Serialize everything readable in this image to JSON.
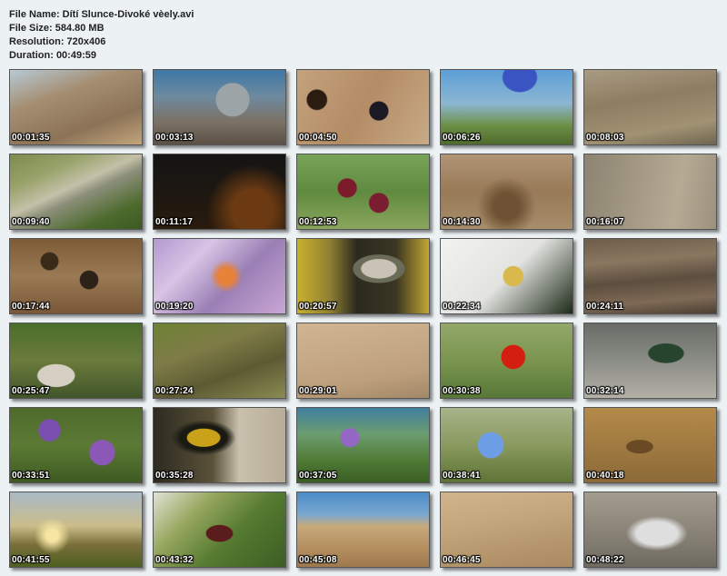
{
  "info": {
    "file_name": "File Name: Dítí Slunce-Divoké vèely.avi",
    "file_size": "File Size: 584.80 MB",
    "resolution": "Resolution: 720x406",
    "duration": "Duration: 00:49:59"
  },
  "thumbnails": [
    {
      "time": "00:01:35",
      "bg": "linear-gradient(160deg,#b7c9d6 0%,#a48d70 35%,#8c7357 70%,#c2a57c 100%)"
    },
    {
      "time": "00:03:13",
      "bg": "radial-gradient(circle at 60% 40%,#9da4a7 0 18%,transparent 19%),linear-gradient(180deg,#3e77a6 0%,#6d8aa0 35%,#7b7164 70%,#5a5046 100%)"
    },
    {
      "time": "00:04:50",
      "bg": "radial-gradient(circle at 15% 40%,#2a1c10 0 8%,transparent 9%),radial-gradient(circle at 62% 55%,#1b1a24 0 10%,transparent 11%),linear-gradient(120deg,#c3a27e 0%,#b48c66 50%,#c7aa86 100%)"
    },
    {
      "time": "00:06:26",
      "bg": "radial-gradient(ellipse at 60% 10%,#3a55c2 0 15%,transparent 16%),linear-gradient(180deg,#5c9fd7 0%,#8cb6d2 45%,#6c8f43 75%,#4e6a2e 100%)"
    },
    {
      "time": "00:08:03",
      "bg": "linear-gradient(170deg,#a99b83 0%,#8d7d62 40%,#a19273 75%,#6f6550 100%)"
    },
    {
      "time": "00:09:40",
      "bg": "linear-gradient(155deg,#7d8b4d 0%,#97a26a 25%,#c5c0a8 45%,#8b8f7a 55%,#4c6a2c 80%,#3d5a24 100%)"
    },
    {
      "time": "00:11:17",
      "bg": "radial-gradient(circle at 75% 75%,#6b3a12 0 18%,transparent 40%),linear-gradient(180deg,#141414 0%,#1f1810 60%,#2a1b0d 100%)"
    },
    {
      "time": "00:12:53",
      "bg": "radial-gradient(circle at 38% 45%,#7b1b2c 0 10%,transparent 11%),radial-gradient(circle at 62% 65%,#7a1d31 0 10%,transparent 11%),linear-gradient(180deg,#7aa35a 0%,#5f8a3f 50%,#8aa65c 100%)"
    },
    {
      "time": "00:14:30",
      "bg": "radial-gradient(circle at 50% 70%,#6d5233 0 15%,transparent 35%),linear-gradient(180deg,#b09474 0%,#987a58 50%,#a78d6b 100%)"
    },
    {
      "time": "00:16:07",
      "bg": "linear-gradient(100deg,#8c8371 0%,#a39984 40%,#b5ab95 70%,#9b917c 100%)"
    },
    {
      "time": "00:17:44",
      "bg": "radial-gradient(circle at 30% 30%,#3a2a18 0 8%,transparent 9%),radial-gradient(circle at 60% 55%,#2d2218 0 10%,transparent 11%),linear-gradient(180deg,#7d5b36 0%,#9a7a54 50%,#7a5838 100%)"
    },
    {
      "time": "00:19:20",
      "bg": "radial-gradient(circle at 55% 50%,#e6823a 0 10%,transparent 20%),linear-gradient(135deg,#b29ad0 0%,#d8c4e4 30%,#9a7fb5 60%,#c9a6d4 100%)"
    },
    {
      "time": "00:20:57",
      "bg": "radial-gradient(ellipse at 62% 40%,#c9c2b5 0 15%,#6b6b5a 16% 22%,transparent 23%),linear-gradient(90deg,#c9b12e 0%,#8f8032 25%,#2b2a20 45%,#3b3522 75%,#c2a634 100%)"
    },
    {
      "time": "00:22:34",
      "bg": "radial-gradient(circle at 55% 50%,#d9b84e 0 12%,transparent 13%),linear-gradient(135deg,#f2f2f0 0%,#e3e4e1 50%,#1d2a18 100%)"
    },
    {
      "time": "00:24:11",
      "bg": "linear-gradient(175deg,#6e5c4a 0%,#8a7760 30%,#5d4e3f 55%,#7e6a55 80%,#4b3e32 100%)"
    },
    {
      "time": "00:25:47",
      "bg": "radial-gradient(ellipse at 35% 70%,#d6d0c4 0 15%,transparent 16%),linear-gradient(180deg,#4b6e2b 0%,#6b7b3b 50%,#41552a 100%)"
    },
    {
      "time": "00:27:24",
      "bg": "linear-gradient(160deg,#6b8233 0%,#7f7c47 35%,#5d5a33 65%,#8a8b51 100%)"
    },
    {
      "time": "00:29:01",
      "bg": "linear-gradient(170deg,#d1b492 0%,#c6a986 40%,#bd9f7b 70%,#a38868 100%)"
    },
    {
      "time": "00:30:38",
      "bg": "radial-gradient(circle at 55% 45%,#d41f10 0 14%,transparent 15%),linear-gradient(180deg,#93a86a 0%,#7a954f 50%,#587838 100%)"
    },
    {
      "time": "00:32:14",
      "bg": "radial-gradient(ellipse at 62% 40%,#27442f 0 15%,transparent 16%),linear-gradient(180deg,#6a6d67 0%,#8a8c86 50%,#b3b1a6 100%)"
    },
    {
      "time": "00:33:51",
      "bg": "radial-gradient(circle at 30% 30%,#7b4fb0 0 10%,transparent 11%),radial-gradient(circle at 70% 60%,#8b58b8 0 12%,transparent 13%),linear-gradient(180deg,#4f6a2c 0%,#5b7a34 50%,#3f5a23 100%)"
    },
    {
      "time": "00:35:28",
      "bg": "radial-gradient(ellipse at 38% 40%,#c9a21a 0 14%,#1a1a12 15% 20%,transparent 28%),linear-gradient(90deg,#2d2a20 0%,#5a5139 45%,#c9c0ad 65%,#b8ad97 100%)"
    },
    {
      "time": "00:37:05",
      "bg": "radial-gradient(circle at 40% 40%,#9567c4 0 10%,transparent 11%),linear-gradient(180deg,#3f7fa0 0%,#6c9d70 35%,#4f7b35 70%,#3a5e24 100%)"
    },
    {
      "time": "00:38:41",
      "bg": "radial-gradient(circle at 38% 50%,#6e9ee6 0 14%,transparent 15%),linear-gradient(180deg,#a7b38a 0%,#8a9a60 50%,#5e7435 100%)"
    },
    {
      "time": "00:40:18",
      "bg": "radial-gradient(ellipse at 42% 52%,#6a4a24 0 12%,transparent 13%),linear-gradient(180deg,#b48a4a 0%,#a07a40 50%,#8c6a38 100%)"
    },
    {
      "time": "00:41:55",
      "bg": "radial-gradient(circle at 32% 58%,#f6e6a4 0 6%,transparent 18%),linear-gradient(180deg,#a9b9c6 0%,#cbbd8a 45%,#7a6f3a 70%,#4f5f22 100%)"
    },
    {
      "time": "00:43:32",
      "bg": "radial-gradient(ellipse at 50% 55%,#5a1c1c 0 14%,transparent 15%),linear-gradient(135deg,#dfe3d6 0%,#96a65e 30%,#557a30 60%,#3c5e24 100%)"
    },
    {
      "time": "00:45:08",
      "bg": "linear-gradient(180deg,#4b8cc9 0%,#7ba8d0 30%,#c6a97a 45%,#b48e5f 75%,#9d7a4e 100%)"
    },
    {
      "time": "00:46:45",
      "bg": "linear-gradient(170deg,#d0b48b 0%,#c4a67c 40%,#b6976d 70%,#a98a61 100%)"
    },
    {
      "time": "00:48:22",
      "bg": "radial-gradient(ellipse at 55% 55%,#dedede 0 20%,transparent 30%),linear-gradient(180deg,#a39d90 0%,#8b8579 50%,#6f6a60 100%)"
    }
  ]
}
